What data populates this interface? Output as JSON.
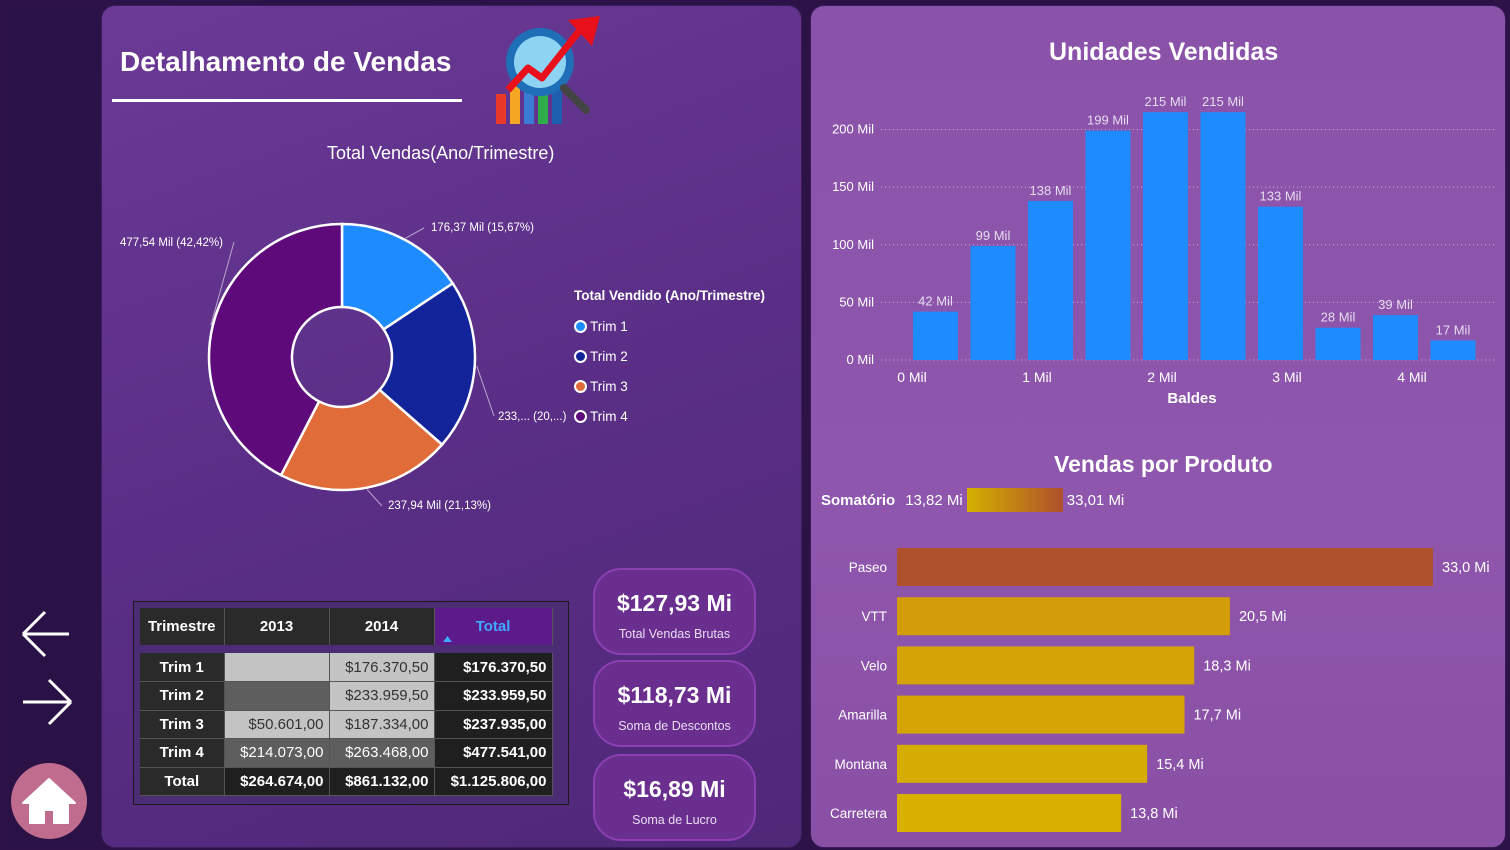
{
  "page": {
    "title": "Detalhamento de Vendas"
  },
  "nav": {
    "back_icon": "arrow-left-icon",
    "forward_icon": "arrow-right-icon",
    "home_icon": "home-icon"
  },
  "donut": {
    "legend_title": "Total Vendido (Ano/Trimestre)",
    "labels": {
      "trim1": "176,37 Mil (15,67%)",
      "trim2": "233,... (20,...)",
      "trim3": "237,94 Mil (21,13%)",
      "trim4": "477,54 Mil (42,42%)"
    },
    "legend": [
      "Trim 1",
      "Trim 2",
      "Trim 3",
      "Trim 4"
    ]
  },
  "table": {
    "headers": [
      "Trimestre",
      "2013",
      "2014",
      "Total"
    ],
    "rows": [
      [
        "Trim 1",
        "",
        "$176.370,50",
        "$176.370,50"
      ],
      [
        "Trim 2",
        "",
        "$233.959,50",
        "$233.959,50"
      ],
      [
        "Trim 3",
        "$50.601,00",
        "$187.334,00",
        "$237.935,00"
      ],
      [
        "Trim 4",
        "$214.073,00",
        "$263.468,00",
        "$477.541,00"
      ],
      [
        "Total",
        "$264.674,00",
        "$861.132,00",
        "$1.125.806,00"
      ]
    ]
  },
  "kpis": [
    {
      "value": "$127,93 Mi",
      "label": "Total Vendas Brutas"
    },
    {
      "value": "$118,73 Mi",
      "label": "Soma de  Descontos"
    },
    {
      "value": "$16,89 Mi",
      "label": "Soma de Lucro"
    }
  ],
  "colors": {
    "trim1": "#1e8cff",
    "trim2": "#13239a",
    "trim3": "#e06c3a",
    "trim4": "#5e0a7a",
    "units_bar": "#1e8cff",
    "product_low": "#d8b000",
    "product_high": "#ad502b"
  },
  "chart_data": [
    {
      "type": "pie",
      "title": "Total Vendas(Ano/Trimestre)",
      "categories": [
        "Trim 1",
        "Trim 2",
        "Trim 3",
        "Trim 4"
      ],
      "values": [
        176.37,
        233.96,
        237.94,
        477.54
      ],
      "percent": [
        15.67,
        20.78,
        21.13,
        42.42
      ],
      "unit": "Mil",
      "legend_placement": "right"
    },
    {
      "type": "bar",
      "title": "Unidades Vendidas",
      "xlabel": "Baldes",
      "ylabel": "",
      "xticks": [
        "0 Mil",
        "1 Mil",
        "2 Mil",
        "3 Mil",
        "4 Mil"
      ],
      "yticks": [
        "0 Mil",
        "50 Mil",
        "100 Mil",
        "150 Mil",
        "200 Mil"
      ],
      "ylim": [
        0,
        215
      ],
      "values": [
        42,
        99,
        138,
        199,
        215,
        215,
        133,
        28,
        39,
        17
      ],
      "value_labels": [
        "42 Mil",
        "99 Mil",
        "138 Mil",
        "199 Mil",
        "215 Mil",
        "215 Mil",
        "133 Mil",
        "28 Mil",
        "39 Mil",
        "17 Mil"
      ],
      "grid": true
    },
    {
      "type": "bar",
      "orientation": "horizontal",
      "title": "Vendas por Produto",
      "legend": {
        "label": "Somatório",
        "min": "13,82 Mi",
        "max": "33,01 Mi"
      },
      "categories": [
        "Paseo",
        "VTT",
        "Velo",
        "Amarilla",
        "Montana",
        "Carretera"
      ],
      "values": [
        33.0,
        20.5,
        18.3,
        17.7,
        15.4,
        13.8
      ],
      "value_labels": [
        "33,0 Mi",
        "20,5 Mi",
        "18,3 Mi",
        "17,7 Mi",
        "15,4 Mi",
        "13,8 Mi"
      ]
    }
  ]
}
